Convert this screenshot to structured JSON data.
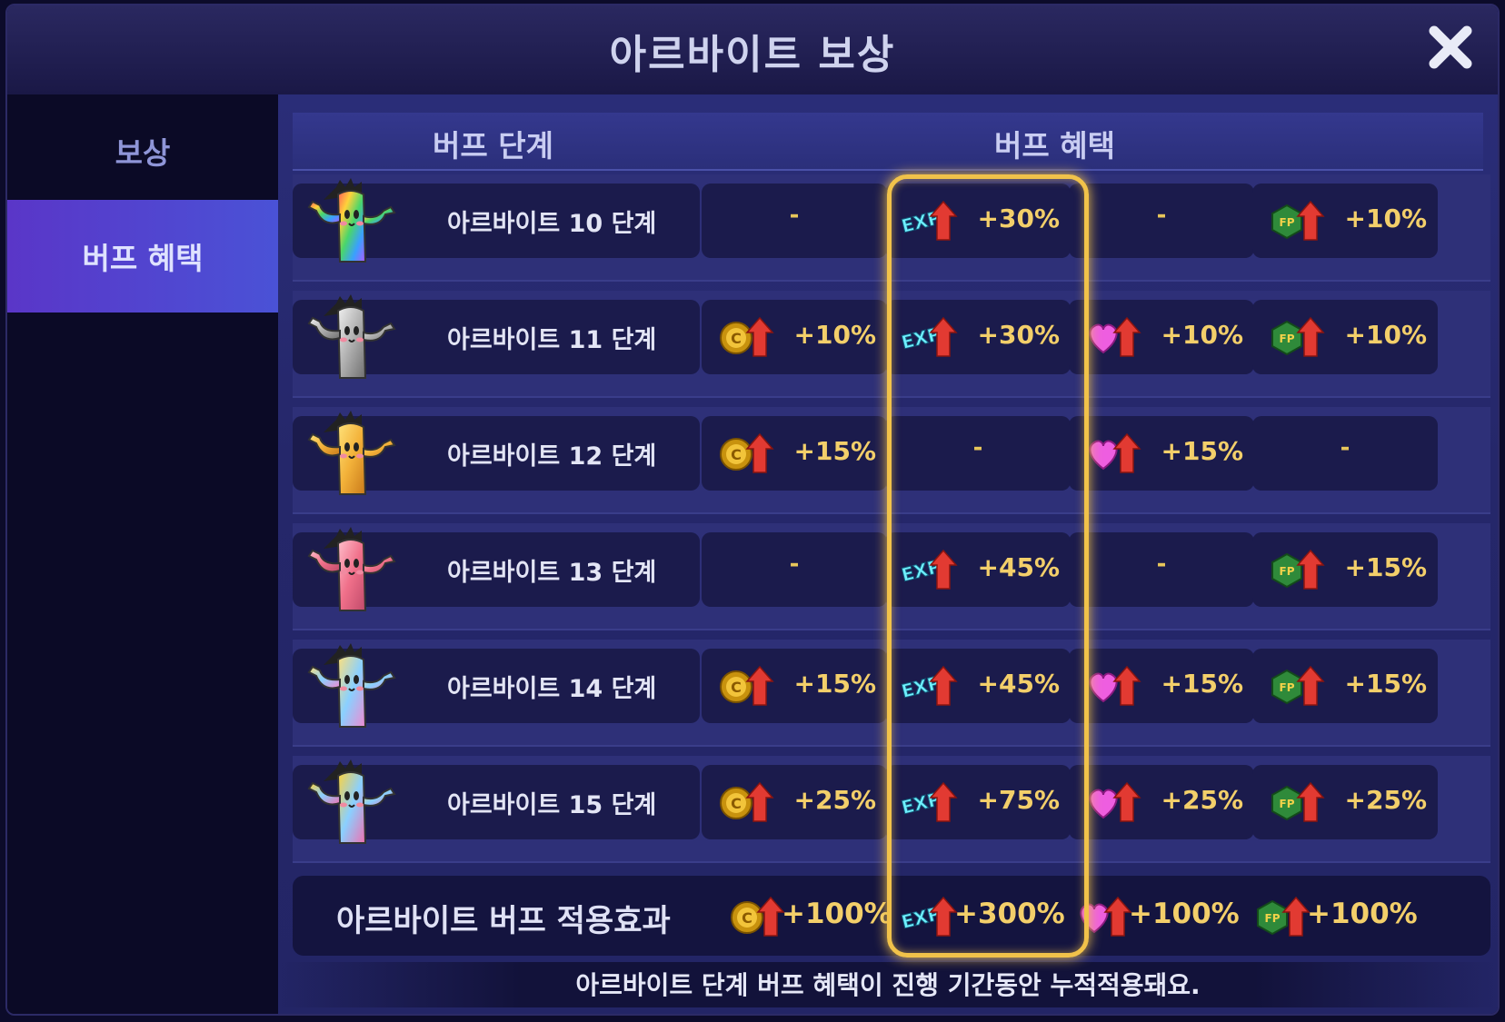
{
  "window": {
    "title": "아르바이트 보상",
    "close_icon": "close-icon"
  },
  "sidebar": {
    "items": [
      {
        "label": "보상",
        "active": false
      },
      {
        "label": "버프 혜택",
        "active": true
      }
    ]
  },
  "table": {
    "headers": {
      "stage": "버프 단계",
      "benefit": "버프 혜택"
    },
    "rows": [
      {
        "stage": "아르바이트 10 단계",
        "char_color": "rainbow",
        "coin": "-",
        "exp": "+30%",
        "heart": "-",
        "fp": "+10%"
      },
      {
        "stage": "아르바이트 11 단계",
        "char_color": "silver",
        "coin": "+10%",
        "exp": "+30%",
        "heart": "+10%",
        "fp": "+10%"
      },
      {
        "stage": "아르바이트 12 단계",
        "char_color": "gold",
        "coin": "+15%",
        "exp": "-",
        "heart": "+15%",
        "fp": "-"
      },
      {
        "stage": "아르바이트 13 단계",
        "char_color": "pink",
        "coin": "-",
        "exp": "+45%",
        "heart": "-",
        "fp": "+15%"
      },
      {
        "stage": "아르바이트 14 단계",
        "char_color": "pastel",
        "coin": "+15%",
        "exp": "+45%",
        "heart": "+15%",
        "fp": "+15%"
      },
      {
        "stage": "아르바이트 15 단계",
        "char_color": "candy",
        "coin": "+25%",
        "exp": "+75%",
        "heart": "+25%",
        "fp": "+25%"
      }
    ],
    "total": {
      "label": "아르바이트 버프 적용효과",
      "coin": "+100%",
      "exp": "+300%",
      "heart": "+100%",
      "fp": "+100%"
    }
  },
  "footer": "아르바이트 단계 버프 혜택이 진행 기간동안 누적적용돼요.",
  "icons": {
    "coin": "coin-up-icon",
    "exp": "exp-up-icon",
    "heart": "heart-up-icon",
    "fp": "fp-up-icon"
  },
  "colors": {
    "highlight": "#f1c24a",
    "value": "#f3cf6a",
    "accent": "#5a36c8"
  }
}
